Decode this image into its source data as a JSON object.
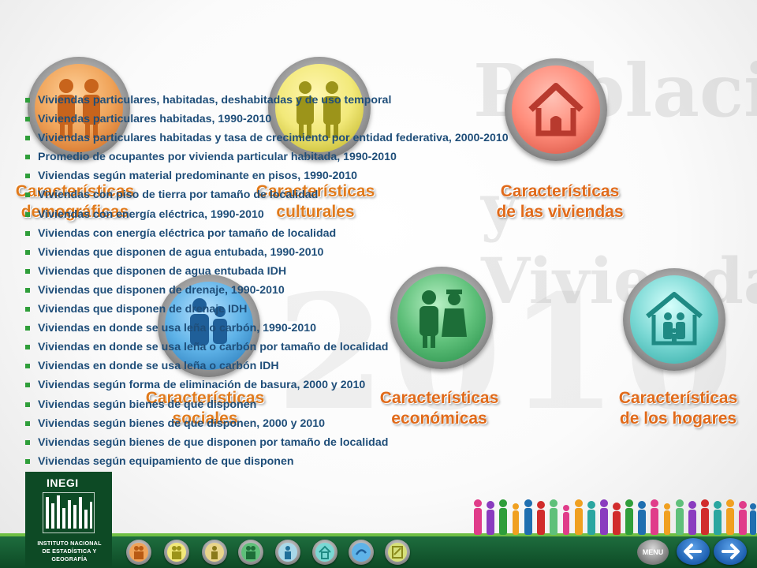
{
  "watermark": {
    "line1": "Población",
    "line2": "y Vivienda",
    "year": "2010"
  },
  "categories": [
    {
      "id": "demograficas",
      "line1": "Características",
      "line2": "demográficas",
      "color": "#e07a1c",
      "disc": "#f0a45a",
      "icon": "two-people-icon"
    },
    {
      "id": "culturales",
      "line1": "Características",
      "line2": "culturales",
      "color": "#d1c41a",
      "disc": "#f2e97a",
      "icon": "graduate-people-icon"
    },
    {
      "id": "viviendas",
      "line1": "Características",
      "line2": "de las viviendas",
      "color": "#e06a1a",
      "disc": "#ff8c7a",
      "icon": "house-icon"
    },
    {
      "id": "sociales",
      "line1": "Características",
      "line2": "sociales",
      "color": "#e07a1c",
      "disc": "#5fb3e8",
      "icon": "people-icon"
    },
    {
      "id": "economicas",
      "line1": "Características",
      "line2": "económicas",
      "color": "#e06a1a",
      "disc": "#5fc07a",
      "icon": "worker-nurse-icon"
    },
    {
      "id": "hogares",
      "line1": "Características",
      "line2": "de los hogares",
      "color": "#e06a1a",
      "disc": "#7ad8d4",
      "icon": "family-house-icon"
    }
  ],
  "items": [
    "Viviendas particulares, habitadas, deshabitadas y de uso temporal",
    "Viviendas particulares habitadas, 1990-2010",
    "Viviendas particulares habitadas y tasa de crecimiento por entidad federativa, 2000-2010",
    "Promedio de ocupantes por vivienda particular habitada, 1990-2010",
    "Viviendas según material predominante en pisos, 1990-2010",
    "Viviendas con piso de tierra por tamaño de localidad",
    "Viviendas con energía eléctrica, 1990-2010",
    "Viviendas con energía eléctrica por tamaño de localidad",
    "Viviendas que disponen de agua entubada, 1990-2010",
    "Viviendas que disponen de agua entubada IDH",
    "Viviendas que disponen de drenaje, 1990-2010",
    "Viviendas que disponen de drenaje IDH",
    "Viviendas en donde se usa leña o carbón, 1990-2010",
    "Viviendas en donde se usa leña o carbón por tamaño de localidad",
    "Viviendas en donde se usa leña o carbón IDH",
    "Viviendas según forma de eliminación de basura, 2000 y 2010",
    "Viviendas según bienes de que disponen",
    "Viviendas según bienes de que disponen, 2000 y 2010",
    "Viviendas según bienes de que disponen por tamaño de localidad",
    "Viviendas según equipamiento de que disponen"
  ],
  "footer": {
    "logo_title": "INEGI",
    "logo_line1": "INSTITUTO NACIONAL",
    "logo_line2": "DE ESTADÍSTICA Y GEOGRAFÍA",
    "menu_label": "MENU",
    "mini_icons": [
      {
        "name": "demograficas-mini-icon",
        "color": "#f0a45a"
      },
      {
        "name": "culturales-mini-icon",
        "color": "#f2e97a"
      },
      {
        "name": "sociales-mini-icon",
        "color": "#e9d58a"
      },
      {
        "name": "economicas-mini-icon",
        "color": "#5fc07a"
      },
      {
        "name": "hogares-mini-icon",
        "color": "#a8d8e8"
      },
      {
        "name": "viviendas-mini-icon",
        "color": "#7ad8d4"
      },
      {
        "name": "migracion-mini-icon",
        "color": "#5fb3e8"
      },
      {
        "name": "documentos-mini-icon",
        "color": "#d6e07a"
      }
    ]
  },
  "colors": {
    "list_text": "#1f4e79",
    "bullet": "#2f9e3a",
    "footer_bg": "#0d4a25",
    "label_orange": "#e06a1a"
  }
}
